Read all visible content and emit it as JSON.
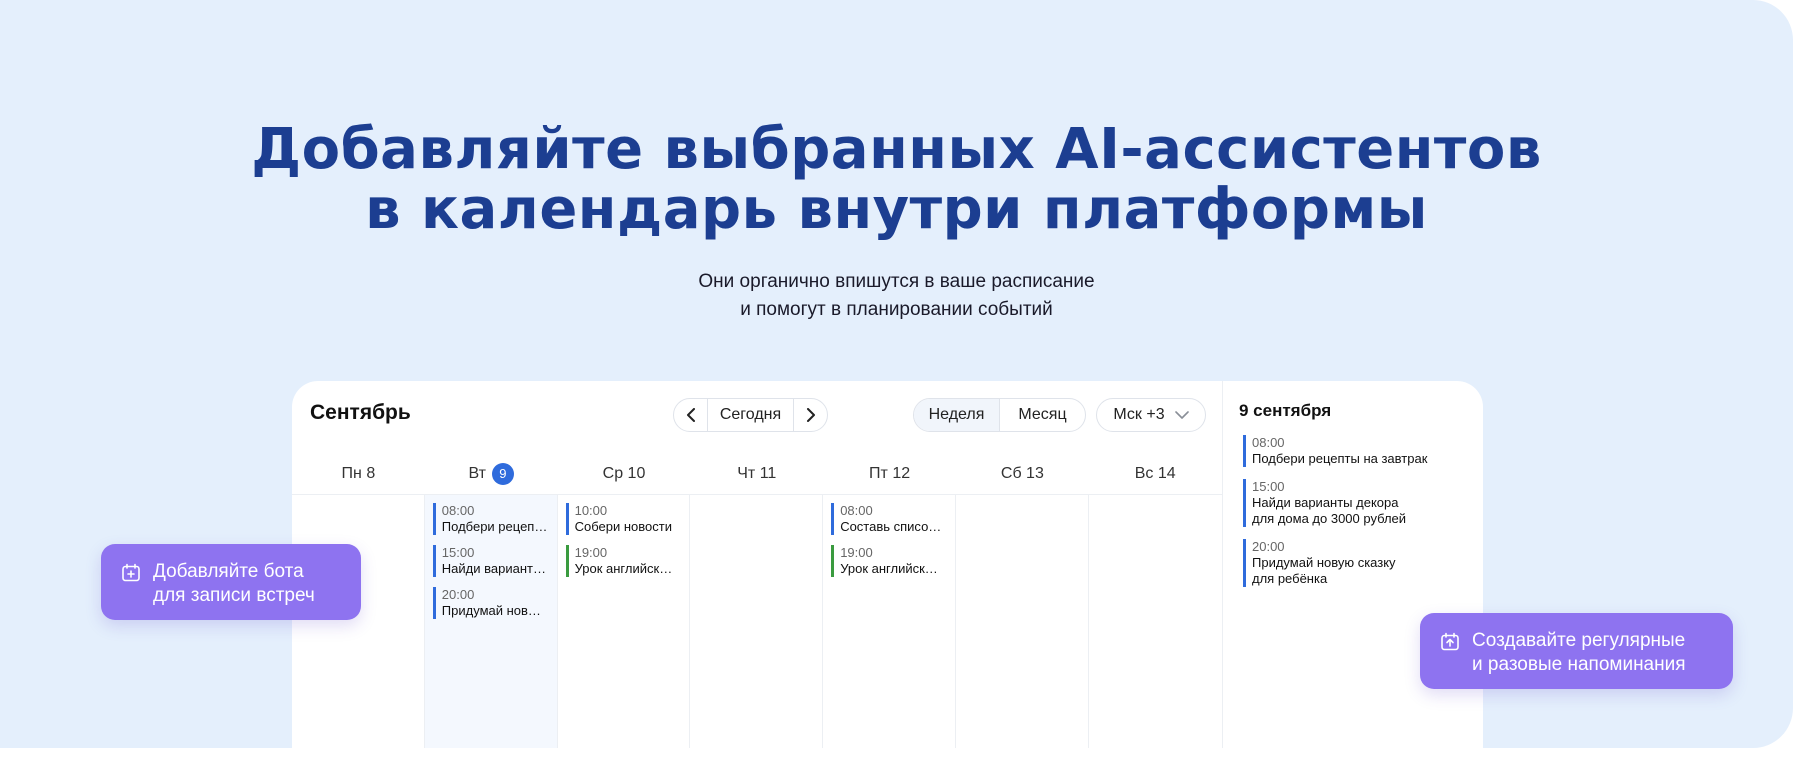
{
  "hero": {
    "headline_line1": "Добавляйте выбранных AI-ассистентов",
    "headline_line2": "в календарь внутри платформы",
    "subtitle_line1": "Они органично впишутся в ваше расписание",
    "subtitle_line2": "и помогут в планировании событий"
  },
  "calendar": {
    "month": "Сентябрь",
    "nav": {
      "prev": "‹",
      "today": "Сегодня",
      "next": "›"
    },
    "views": {
      "week": "Неделя",
      "month": "Месяц"
    },
    "timezone": "Мск +3",
    "days": [
      {
        "label": "Пн 8"
      },
      {
        "label": "Вт",
        "badge": "9"
      },
      {
        "label": "Ср 10"
      },
      {
        "label": "Чт 11"
      },
      {
        "label": "Пт 12"
      },
      {
        "label": "Сб 13"
      },
      {
        "label": "Вс 14"
      }
    ],
    "events": {
      "tue": [
        {
          "time": "08:00",
          "title": "Подбери рецеп…"
        },
        {
          "time": "15:00",
          "title": "Найди вариант…"
        },
        {
          "time": "20:00",
          "title": "Придумай нов…"
        }
      ],
      "wed": [
        {
          "time": "10:00",
          "title": "Собери новости"
        },
        {
          "time": "19:00",
          "title": "Урок английск…"
        }
      ],
      "fri": [
        {
          "time": "08:00",
          "title": "Составь списо…"
        },
        {
          "time": "19:00",
          "title": "Урок английск…"
        }
      ]
    },
    "side": {
      "title": "9 сентября",
      "events": [
        {
          "time": "08:00",
          "line1": "Подбери рецепты на завтрак"
        },
        {
          "time": "15:00",
          "line1": "Найди варианты декора",
          "line2": "для дома до 3000 рублей"
        },
        {
          "time": "20:00",
          "line1": "Придумай новую сказку",
          "line2": "для ребёнка"
        }
      ]
    },
    "colors": {
      "accent_blue": "#2f6bdc",
      "accent_green": "#3a9b3f",
      "pill": "#8e73f0",
      "headline": "#1c3e91",
      "background": "#e4effc"
    }
  },
  "callouts": {
    "left_line1": "Добавляйте бота",
    "left_line2": "для записи встреч",
    "left_icon": "calendar-plus-icon",
    "right_line1": "Создавайте регулярные",
    "right_line2": "и разовые напоминания",
    "right_icon": "calendar-upload-icon"
  }
}
